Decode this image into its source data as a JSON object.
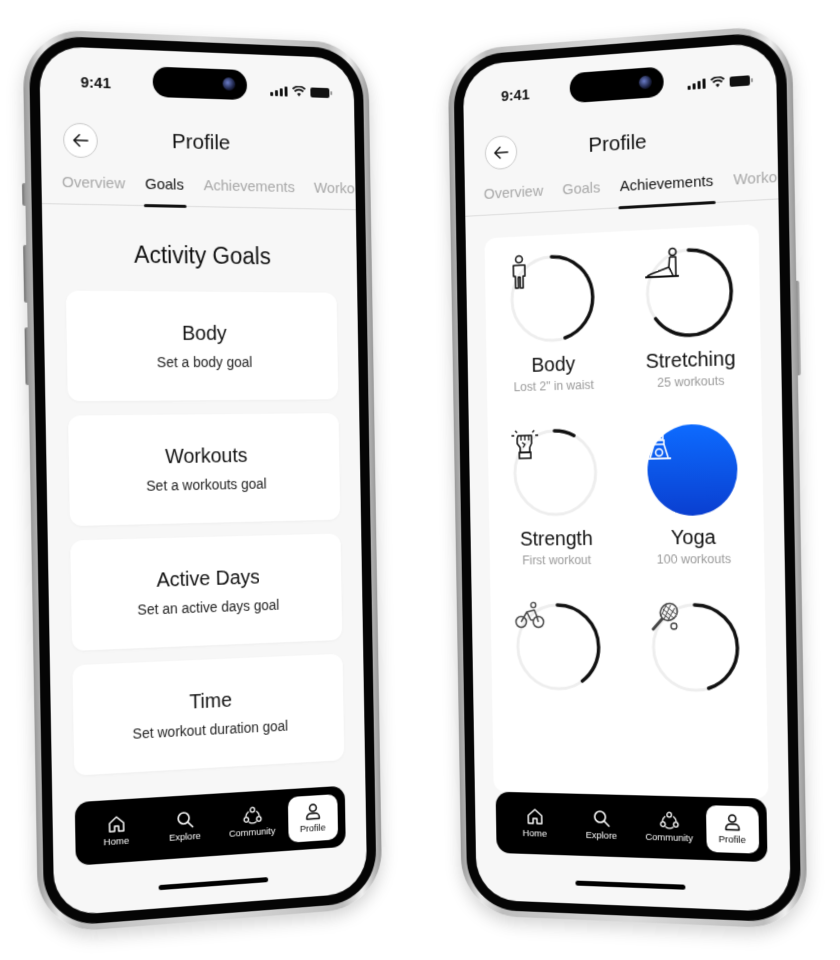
{
  "status_bar": {
    "time": "9:41"
  },
  "left_phone": {
    "title": "Profile",
    "tabs": [
      {
        "label": "Overview",
        "active": false
      },
      {
        "label": "Goals",
        "active": true
      },
      {
        "label": "Achievements",
        "active": false
      },
      {
        "label": "Workouts",
        "active": false
      }
    ],
    "section_title": "Activity Goals",
    "goals": [
      {
        "title": "Body",
        "subtitle": "Set a body goal"
      },
      {
        "title": "Workouts",
        "subtitle": "Set a workouts goal"
      },
      {
        "title": "Active Days",
        "subtitle": "Set an active days goal"
      },
      {
        "title": "Time",
        "subtitle": "Set workout duration goal"
      }
    ]
  },
  "right_phone": {
    "title": "Profile",
    "tabs": [
      {
        "label": "Overview",
        "active": false
      },
      {
        "label": "Goals",
        "active": false
      },
      {
        "label": "Achievements",
        "active": true
      },
      {
        "label": "Workouts",
        "active": false
      }
    ],
    "achievements": [
      {
        "name": "Body",
        "description": "Lost 2\" in waist",
        "icon": "person-icon",
        "progress": 0.45,
        "completed": false
      },
      {
        "name": "Stretching",
        "description": "25 workouts",
        "icon": "stretching-icon",
        "progress": 0.65,
        "completed": false
      },
      {
        "name": "Strength",
        "description": "First workout",
        "icon": "fist-icon",
        "progress": 0.08,
        "completed": false
      },
      {
        "name": "Yoga",
        "description": "100 workouts",
        "icon": "yoga-icon",
        "progress": 1.0,
        "completed": true
      },
      {
        "name": "",
        "description": "",
        "icon": "cycling-icon",
        "progress": 0.4,
        "completed": false
      },
      {
        "name": "",
        "description": "",
        "icon": "tennis-icon",
        "progress": 0.45,
        "completed": false
      }
    ]
  },
  "bottom_nav": [
    {
      "label": "Home",
      "icon": "home-icon",
      "active": false
    },
    {
      "label": "Explore",
      "icon": "search-icon",
      "active": false
    },
    {
      "label": "Community",
      "icon": "community-icon",
      "active": false
    },
    {
      "label": "Profile",
      "icon": "profile-icon",
      "active": true
    }
  ],
  "colors": {
    "accent": "#0b5cf0",
    "accent_dark": "#0a3fd0",
    "ring_track": "#eeeeee",
    "ring_fill": "#111111"
  }
}
